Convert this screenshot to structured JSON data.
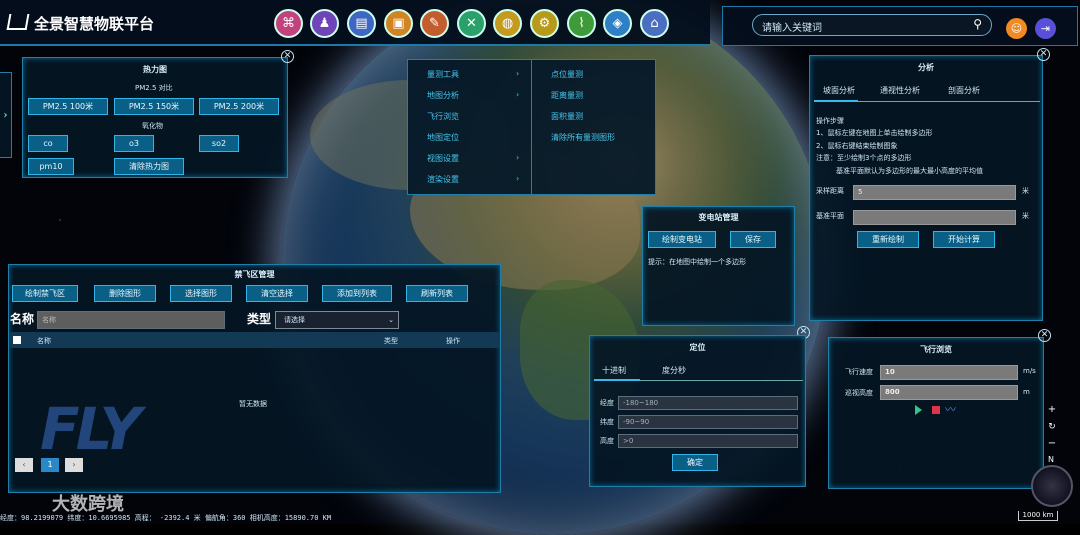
{
  "app": {
    "title": "全景智慧物联平台"
  },
  "search": {
    "placeholder": "请输入关键词"
  },
  "toolbar": [
    "grid-icon",
    "user-pin-icon",
    "layers-icon",
    "camera-icon",
    "map-edit-icon",
    "tools-icon",
    "globe-icon",
    "gear-icon",
    "chart-icon",
    "cube-icon",
    "home-icon"
  ],
  "heatmap": {
    "title": "热力图",
    "pm_label": "PM2.5 对比",
    "pm_buttons": [
      "PM2.5 100米",
      "PM2.5 150米",
      "PM2.5 200米"
    ],
    "oxide_label": "氧化物",
    "oxide_buttons": [
      "co",
      "o3",
      "so2"
    ],
    "pm10": "pm10",
    "clear": "清除热力图"
  },
  "menu": {
    "left": [
      "量测工具",
      "地图分析",
      "飞行浏览",
      "地图定位",
      "视图设置",
      "渲染设置"
    ],
    "right": [
      "点位量测",
      "距离量测",
      "面积量测",
      "清除所有量测图形"
    ]
  },
  "analysis": {
    "title": "分析",
    "tabs": [
      "坡面分析",
      "通视性分析",
      "剖面分析"
    ],
    "steps_title": "操作步骤",
    "steps": [
      "1、鼠标左键在地图上单击绘制多边形",
      "2、鼠标右键结束绘制图象",
      "注意：至少绘制3个点的多边形",
      "基准平面默认为多边形的最大最小高度的平均值"
    ],
    "sample_label": "采样距离",
    "sample_value": "5",
    "sample_unit": "米",
    "base_label": "基准平面",
    "base_value": "",
    "base_unit": "米",
    "redraw": "重新绘制",
    "start": "开始计算"
  },
  "substation": {
    "title": "变电站管理",
    "draw": "绘制变电站",
    "save": "保存",
    "hint": "提示：在地图中绘制一个多边形"
  },
  "nofly": {
    "title": "禁飞区管理",
    "buttons": [
      "绘制禁飞区",
      "删除图形",
      "选择图形",
      "清空选择",
      "添加到列表",
      "刷新列表"
    ],
    "name_label": "名称",
    "name_placeholder": "名称",
    "type_label": "类型",
    "type_value": "请选择",
    "columns": [
      "名称",
      "类型",
      "操作"
    ],
    "empty": "暂无数据",
    "page": "1"
  },
  "locate": {
    "title": "定位",
    "tabs": [
      "十进制",
      "度分秒"
    ],
    "lng_label": "经度",
    "lng_ph": "-180~180",
    "lat_label": "纬度",
    "lat_ph": "-90~90",
    "alt_label": "高度",
    "alt_ph": ">0",
    "confirm": "确定"
  },
  "flight": {
    "title": "飞行浏览",
    "speed_label": "飞行速度",
    "speed_value": "10",
    "speed_unit": "m/s",
    "alt_label": "巡视高度",
    "alt_value": "800",
    "alt_unit": "m"
  },
  "status": {
    "text": "经度：98.2199079 纬度：10.6695985 高程： -2392.4 米 偏航角：360 相机高度：15890.70 KM",
    "scale": "1000 km",
    "compass": "N"
  },
  "watermark": {
    "brand": "大数跨境",
    "logo": "FLY"
  }
}
